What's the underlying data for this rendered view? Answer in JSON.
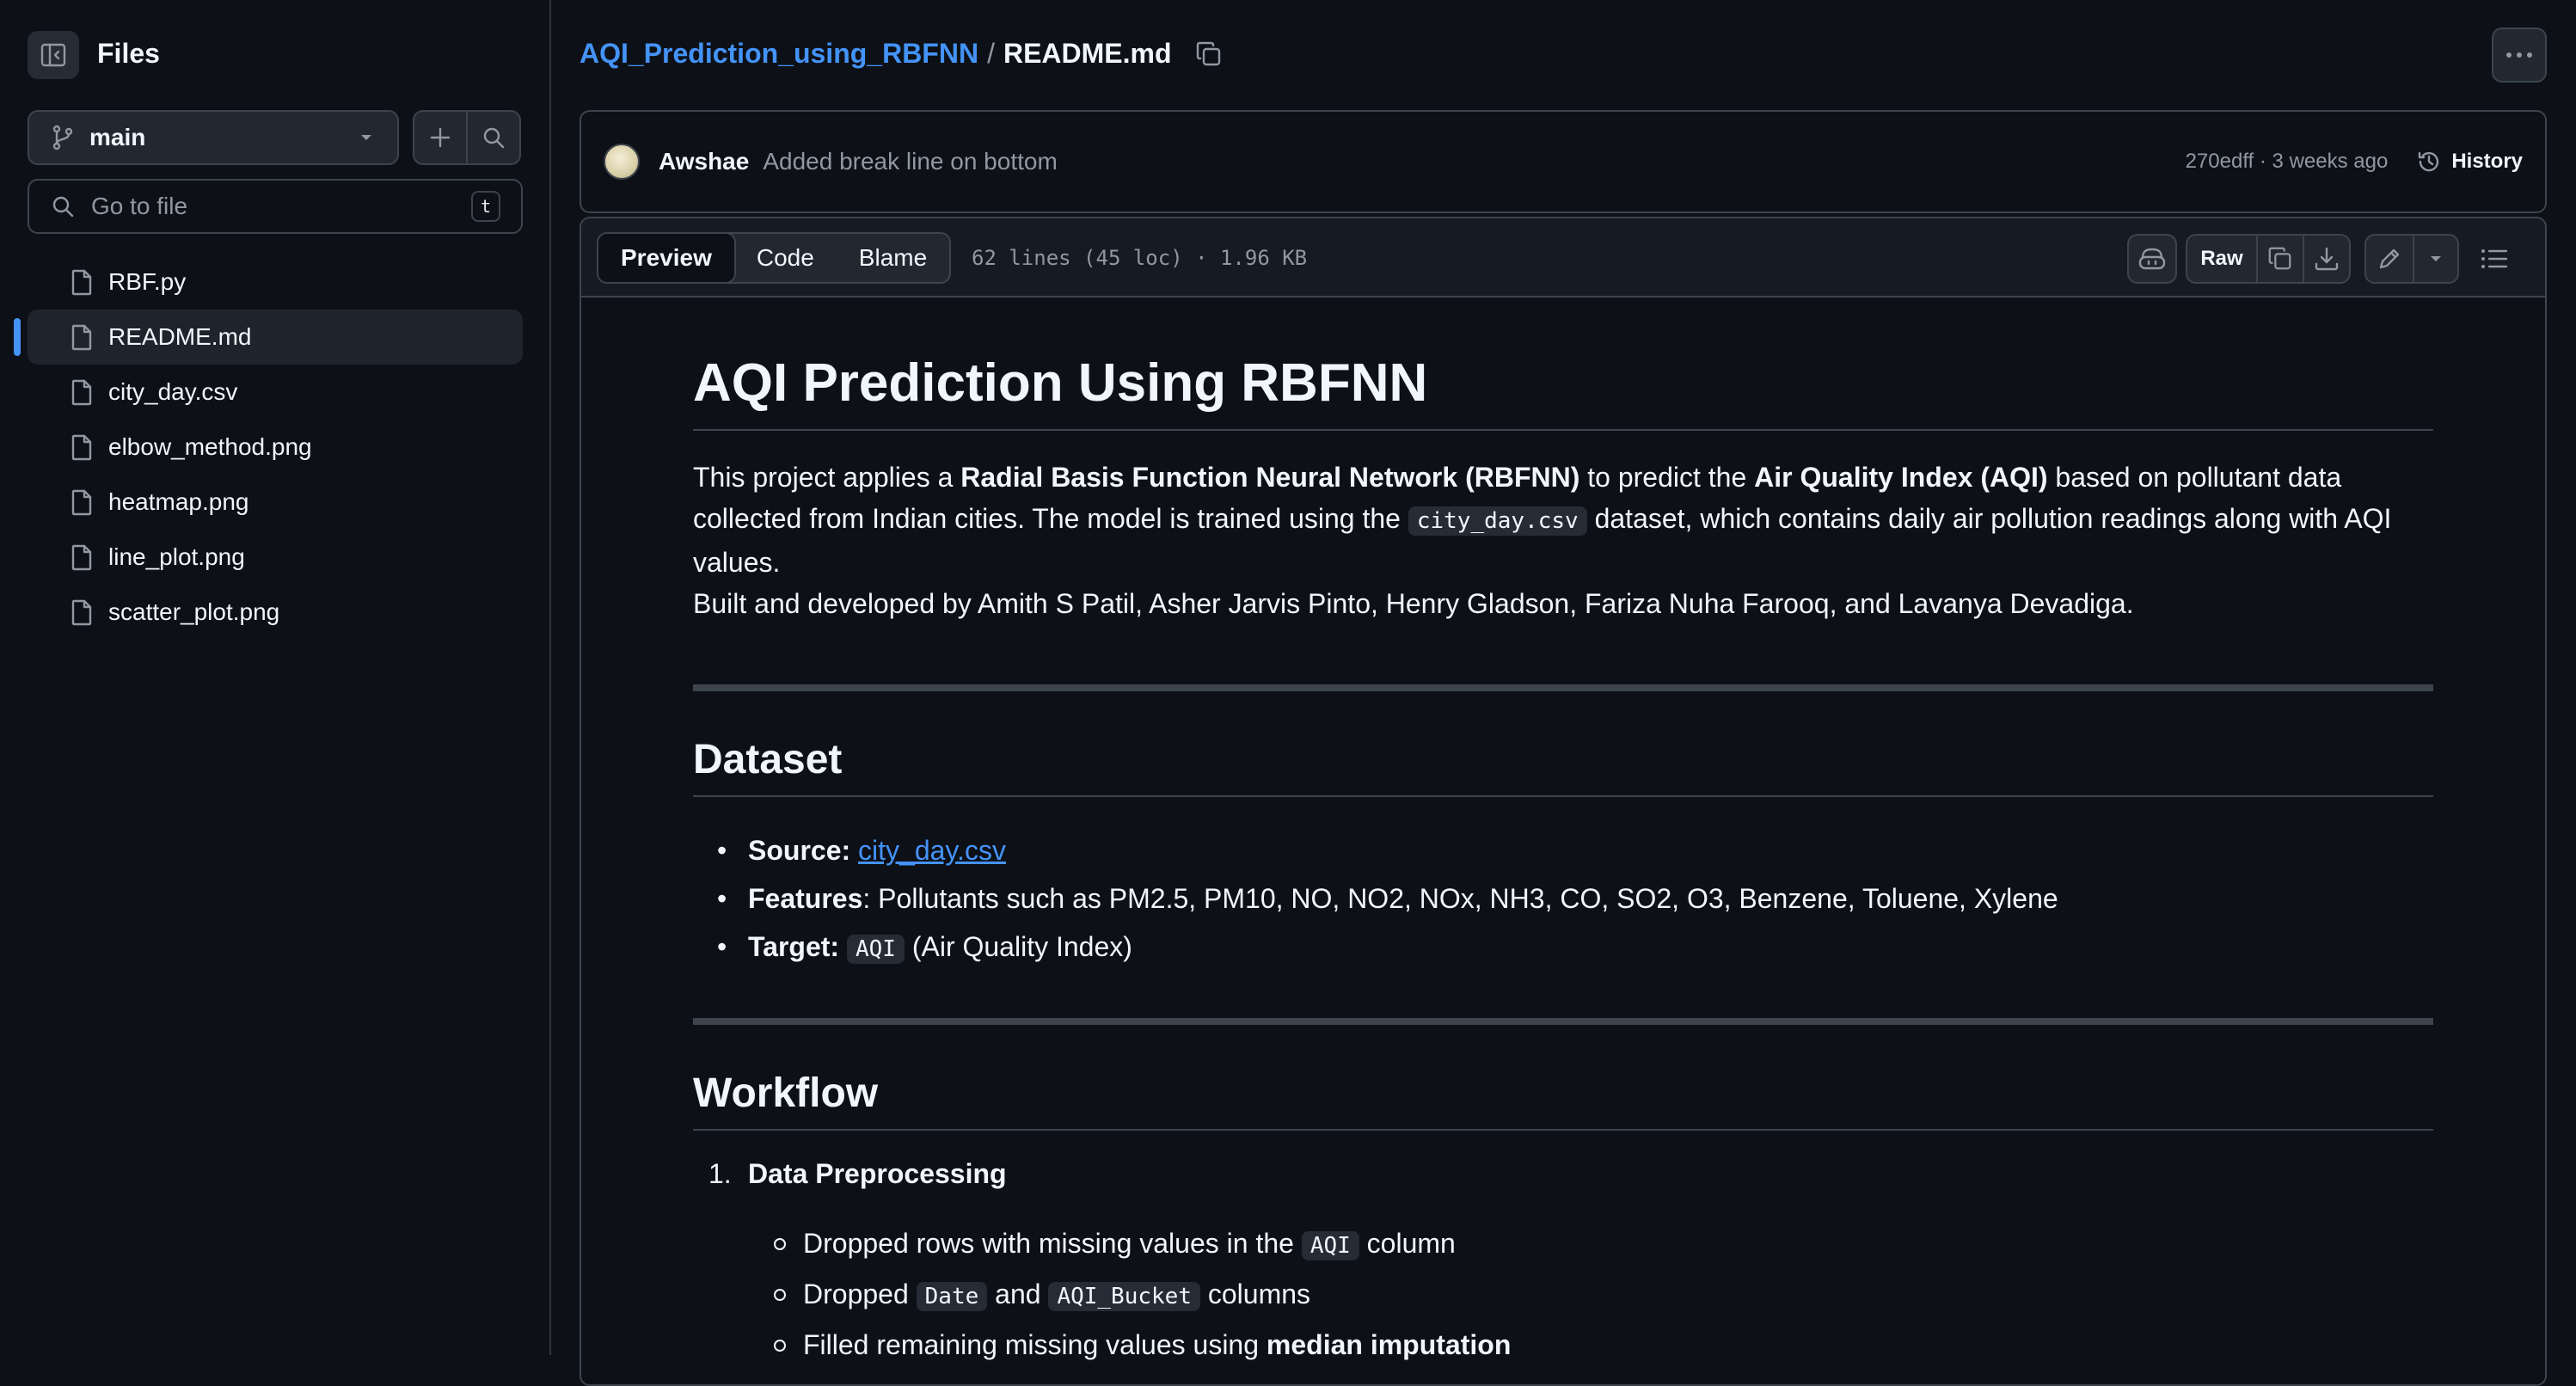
{
  "sidebar": {
    "title": "Files",
    "branch": "main",
    "search": {
      "placeholder": "Go to file",
      "kbd": "t"
    },
    "files": [
      {
        "name": "RBF.py",
        "active": false
      },
      {
        "name": "README.md",
        "active": true
      },
      {
        "name": "city_day.csv",
        "active": false
      },
      {
        "name": "elbow_method.png",
        "active": false
      },
      {
        "name": "heatmap.png",
        "active": false
      },
      {
        "name": "line_plot.png",
        "active": false
      },
      {
        "name": "scatter_plot.png",
        "active": false
      }
    ]
  },
  "header": {
    "repo": "AQI_Prediction_using_RBFNN",
    "separator": "/",
    "file": "README.md"
  },
  "commit": {
    "author": "Awshae",
    "message": "Added break line on bottom",
    "meta": "270edff · 3 weeks ago",
    "history_label": "History"
  },
  "file_header": {
    "tabs": [
      "Preview",
      "Code",
      "Blame"
    ],
    "active_tab": "Preview",
    "stats": "62 lines (45 loc) · 1.96 KB",
    "raw_label": "Raw"
  },
  "readme": {
    "title": "AQI Prediction Using RBFNN",
    "intro": {
      "t1": "This project applies a ",
      "b1": "Radial Basis Function Neural Network (RBFNN)",
      "t2": " to predict the ",
      "b2": "Air Quality Index (AQI)",
      "t3": " based on pollutant data collected from Indian cities. The model is trained using the ",
      "code1": "city_day.csv",
      "t4": " dataset, which contains daily air pollution readings along with AQI values."
    },
    "credits": "Built and developed by Amith S Patil, Asher Jarvis Pinto, Henry Gladson, Fariza Nuha Farooq, and Lavanya Devadiga.",
    "dataset": {
      "heading": "Dataset",
      "source_label": "Source",
      "source_link": "city_day.csv",
      "features_label": "Features",
      "features_value": ": Pollutants such as PM2.5, PM10, NO, NO2, NOx, NH3, CO, SO2, O3, Benzene, Toluene, Xylene",
      "target_label": "Target",
      "target_code": "AQI",
      "target_rest": " (Air Quality Index)"
    },
    "workflow": {
      "heading": "Workflow",
      "step1_num": "1.",
      "step1_title": "Data Preprocessing",
      "s1_a": "Dropped rows with missing values in the ",
      "s1_code": "AQI",
      "s1_b": " column",
      "s2_a": "Dropped ",
      "s2_code1": "Date",
      "s2_mid": " and ",
      "s2_code2": "AQI_Bucket",
      "s2_b": " columns",
      "s3_a": "Filled remaining missing values using ",
      "s3_bold": "median imputation"
    }
  }
}
